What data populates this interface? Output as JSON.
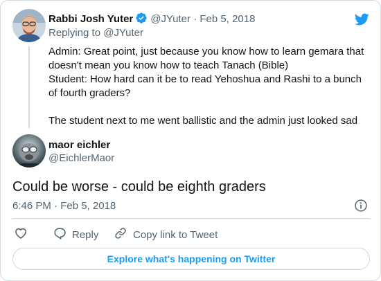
{
  "parent_tweet": {
    "author_name": "Rabbi Josh Yuter",
    "author_handle": "@JYuter",
    "separator": "·",
    "date": "Feb 5, 2018",
    "replying_to": "Replying to @JYuter",
    "text": "Admin: Great point, just because you know how to learn gemara that doesn't mean you know how to teach Tanach (Bible)\nStudent: How hard can it be to read Yehoshua and Rashi to a bunch of fourth graders?\n\nThe student next to me went ballistic and the admin just looked sad"
  },
  "main_tweet": {
    "author_name": "maor eichler",
    "author_handle": "@EichlerMaor",
    "text": "Could be worse - could be eighth graders",
    "timestamp": "6:46 PM · Feb 5, 2018"
  },
  "actions": {
    "reply_label": "Reply",
    "copy_link_label": "Copy link to Tweet"
  },
  "explore_label": "Explore what's happening on Twitter",
  "colors": {
    "brand": "#1d9bf0",
    "muted": "#536471",
    "border": "#cfd9de"
  },
  "icons": [
    "verified-badge-icon",
    "twitter-bird-icon",
    "info-icon",
    "heart-icon",
    "reply-icon",
    "link-icon"
  ]
}
